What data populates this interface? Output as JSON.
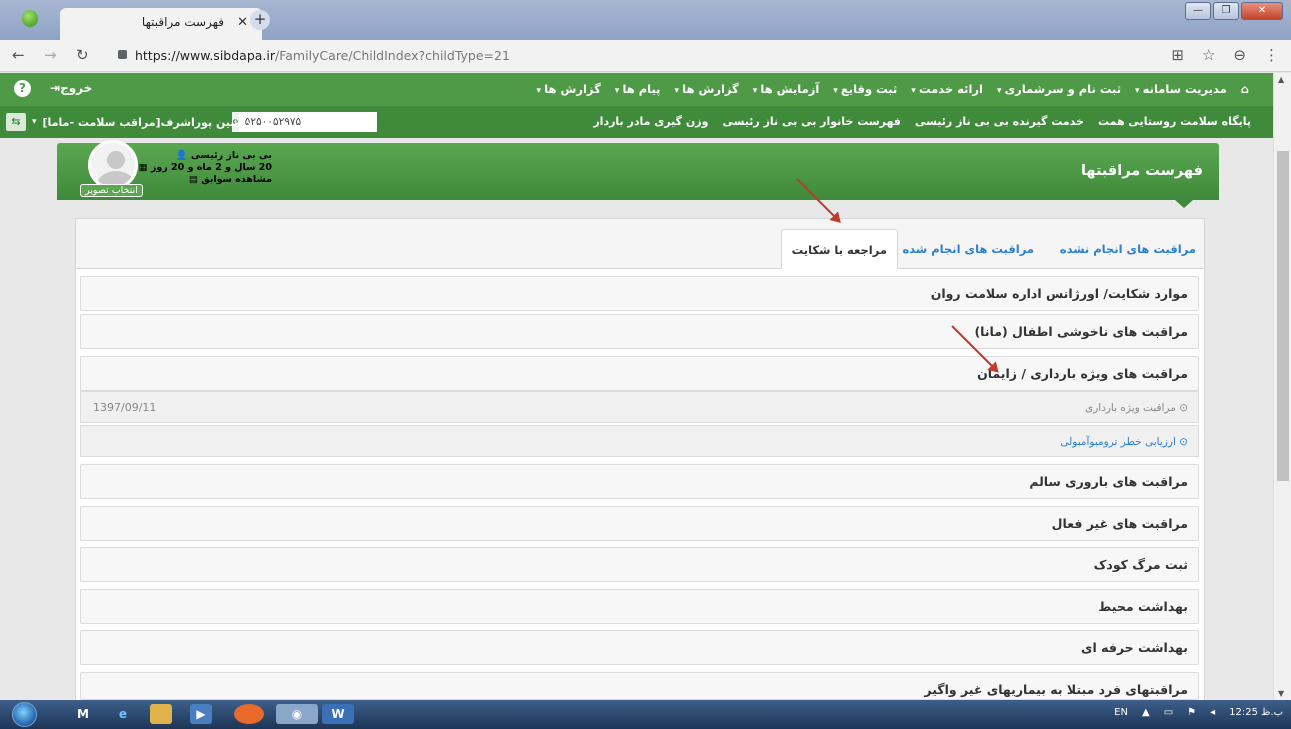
{
  "browser": {
    "tab_title": "فهرست مراقبتها",
    "url_host": "https://www.sibdapa.ir",
    "url_path": "/FamilyCare/ChildIndex?childType=21"
  },
  "header": {
    "menu": [
      "مدیریت سامانه",
      "ثبت نام و سرشماری",
      "ارائه خدمت",
      "ثبت وقایع",
      "آزمایش ها",
      "گزارش ها",
      "پیام ها",
      "گزارش ها"
    ],
    "logout": "خروج",
    "help": "?",
    "menu2": [
      "پایگاه سلامت روستایی همت",
      "خدمت گیرنده بی بی ناز رئیسی",
      "فهرست خانوار بی بی ناز رئیسی",
      "وزن گیری مادر باردار"
    ],
    "search_value": "۵۲۵۰۰۵۲۹۷۵",
    "user_label": "راشین پوراشرف[مراقب سلامت -ماما]"
  },
  "banner": {
    "title": "فهرست مراقبتها",
    "patient_name": "بی بی ناز رئیسی",
    "patient_age": "20 سال و 2 ماه و 20 روز",
    "history_link": "مشاهده سوابق",
    "choose_image": "انتخاب تصویر"
  },
  "tabs": [
    "مراقبت های انجام نشده",
    "مراقبت های انجام شده",
    "مراجعه با شکایت"
  ],
  "rows": [
    "موارد شکایت/ اورژانس اداره سلامت روان",
    "مراقبت های ناخوشی اطفال (مانا)",
    "مراقبت های ویژه بارداری / زایمان"
  ],
  "subrows": [
    {
      "label": "⊙ مراقبت ویژه بارداری",
      "date": "1397/09/11"
    },
    {
      "label": "⊙ ارزیابی خطر ترومبوآمبولی",
      "date": ""
    }
  ],
  "rows_after": [
    "مراقبت های باروری سالم",
    "مراقبت های غیر فعال",
    "ثبت مرگ کودک",
    "بهداشت محیط",
    "بهداشت حرفه ای",
    "مراقبتهای فرد مبتلا به بیماریهای غیر واگیر"
  ],
  "taskbar": {
    "lang": "EN",
    "clock": "ب.ظ 12:25"
  },
  "colors": {
    "header_green": "#4e9a46",
    "link_blue": "#2a7fd0",
    "annotation_red": "#c0392b"
  }
}
